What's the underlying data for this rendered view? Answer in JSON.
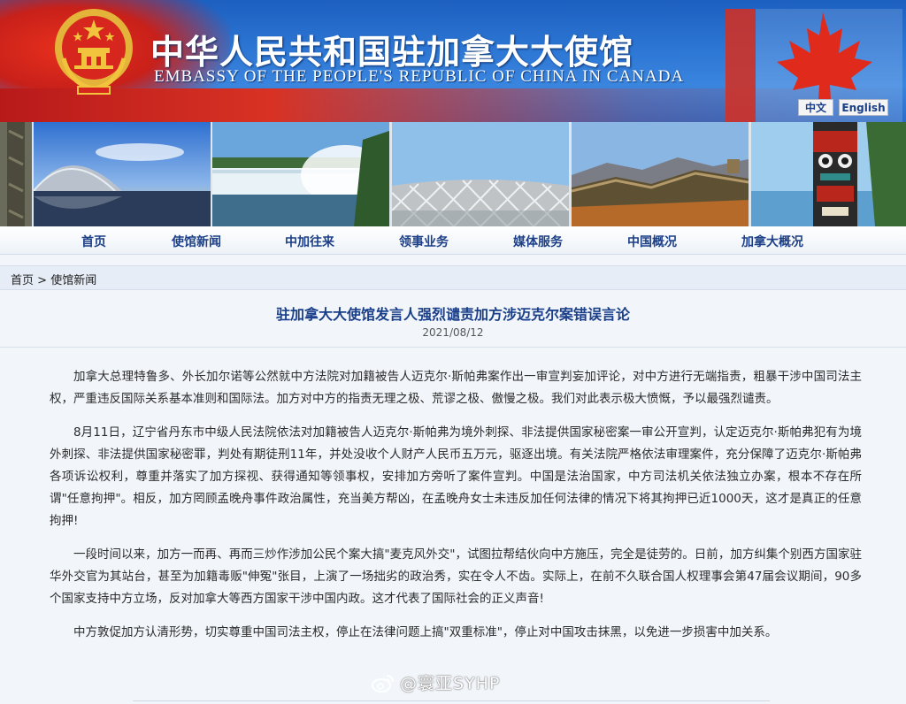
{
  "header": {
    "title_cn": "中华人民共和国驻加拿大大使馆",
    "title_en": "EMBASSY OF THE PEOPLE'S REPUBLIC OF CHINA IN CANADA",
    "lang_cn": "中文",
    "lang_en": "English"
  },
  "nav": {
    "items": [
      "首页",
      "使馆新闻",
      "中加往来",
      "领事业务",
      "媒体服务",
      "中国概况",
      "加拿大概况"
    ]
  },
  "breadcrumb": {
    "home": "首页",
    "separator": " > ",
    "current": "使馆新闻"
  },
  "article": {
    "title": "驻加拿大大使馆发言人强烈谴责加方涉迈克尔案错误言论",
    "date": "2021/08/12",
    "paragraphs": [
      "加拿大总理特鲁多、外长加尔诺等公然就中方法院对加籍被告人迈克尔·斯帕弗案作出一审宣判妄加评论，对中方进行无端指责，粗暴干涉中国司法主权，严重违反国际关系基本准则和国际法。加方对中方的指责无理之极、荒谬之极、傲慢之极。我们对此表示极大愤慨，予以最强烈谴责。",
      "8月11日，辽宁省丹东市中级人民法院依法对加籍被告人迈克尔·斯帕弗为境外刺探、非法提供国家秘密案一审公开宣判，认定迈克尔·斯帕弗犯有为境外刺探、非法提供国家秘密罪，判处有期徒刑11年，并处没收个人财产人民币五万元，驱逐出境。有关法院严格依法审理案件，充分保障了迈克尔·斯帕弗各项诉讼权利，尊重并落实了加方探视、获得通知等领事权，安排加方旁听了案件宣判。中国是法治国家，中方司法机关依法独立办案，根本不存在所谓\"任意拘押\"。相反，加方罔顾孟晚舟事件政治属性，充当美方帮凶，在孟晚舟女士未违反加任何法律的情况下将其拘押已近1000天，这才是真正的任意拘押!",
      "一段时间以来，加方一而再、再而三炒作涉加公民个案大搞\"麦克风外交\"，试图拉帮结伙向中方施压，完全是徒劳的。日前，加方纠集个别西方国家驻华外交官为其站台，甚至为加籍毒贩\"伸冤\"张目，上演了一场拙劣的政治秀，实在令人不齿。实际上，在前不久联合国人权理事会第47届会议期间，90多个国家支持中方立场，反对加拿大等西方国家干涉中国内政。这才代表了国际社会的正义声音!",
      "中方敦促加方认清形势，切实尊重中国司法主权，停止在法律问题上搞\"双重标准\"，停止对中国攻击抹黑，以免进一步损害中加关系。"
    ]
  },
  "watermark": {
    "text": "@寰亚SYHP",
    "icon": "weibo-icon"
  },
  "colors": {
    "banner_blue": "#2f79d6",
    "banner_red": "#d83224",
    "nav_text": "#1c3f86",
    "title_text": "#1a3f8a",
    "page_bg": "#f2f6fb"
  }
}
